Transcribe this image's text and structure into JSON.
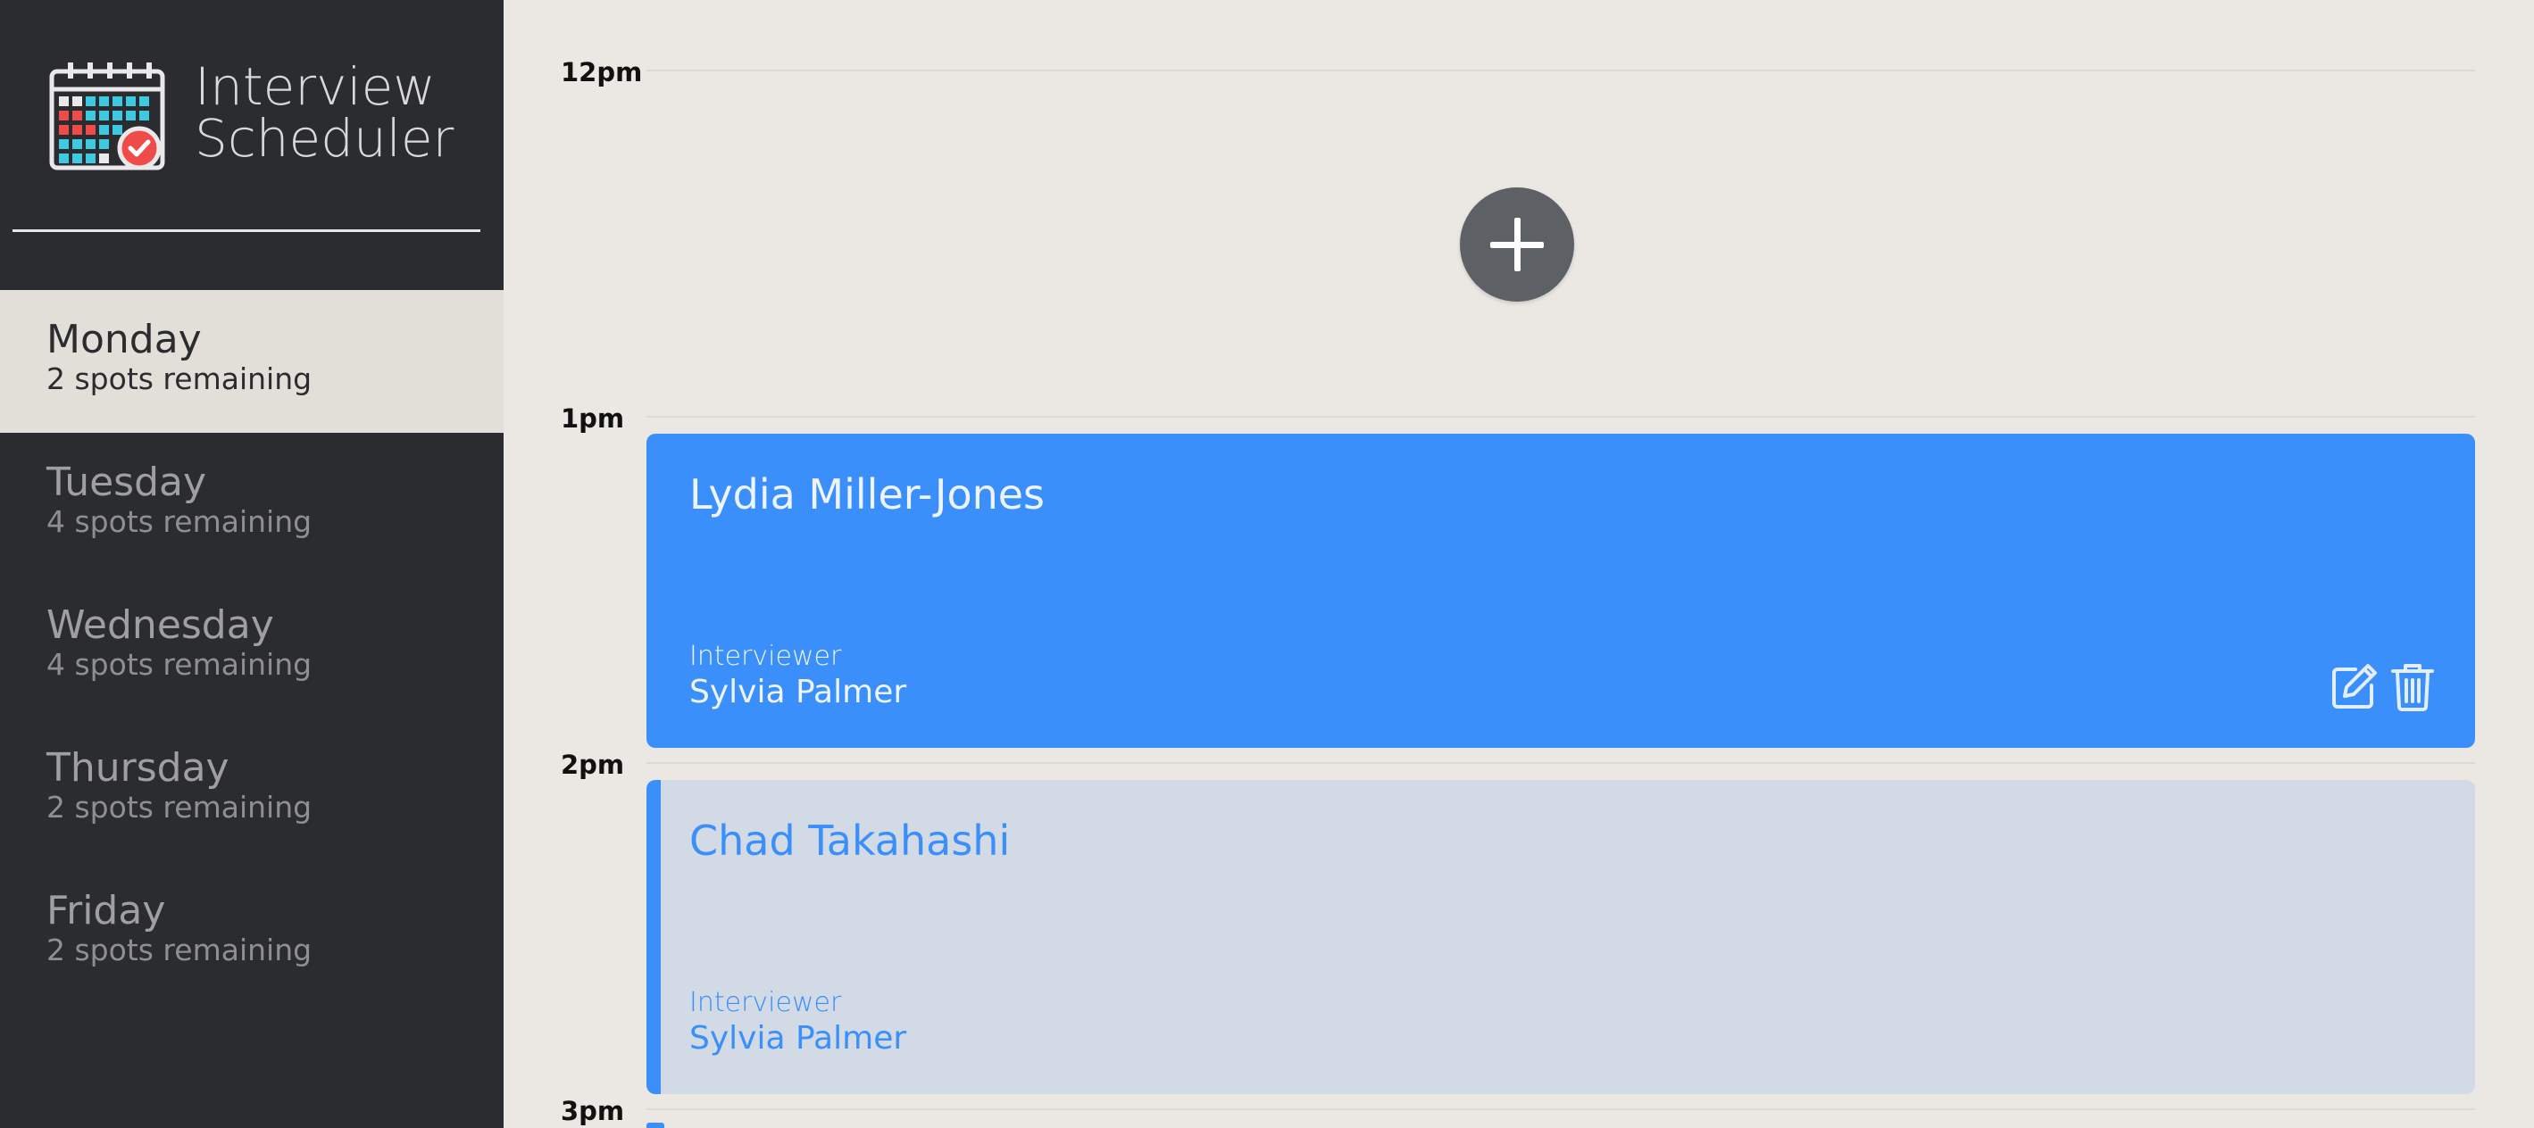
{
  "app": {
    "title_line1": "Interview",
    "title_line2": "Scheduler"
  },
  "sidebar": {
    "days": [
      {
        "name": "Monday",
        "spots": "2 spots remaining",
        "selected": true
      },
      {
        "name": "Tuesday",
        "spots": "4 spots remaining",
        "selected": false
      },
      {
        "name": "Wednesday",
        "spots": "4 spots remaining",
        "selected": false
      },
      {
        "name": "Thursday",
        "spots": "2 spots remaining",
        "selected": false
      },
      {
        "name": "Friday",
        "spots": "2 spots remaining",
        "selected": false
      }
    ]
  },
  "schedule": {
    "hours": [
      "12pm",
      "1pm",
      "2pm",
      "3pm"
    ],
    "appointments": [
      {
        "student": "Lydia Miller-Jones",
        "interviewer_label": "Interviewer",
        "interviewer": "Sylvia Palmer",
        "style": "hovered"
      },
      {
        "student": "Chad Takahashi",
        "interviewer_label": "Interviewer",
        "interviewer": "Sylvia Palmer",
        "style": "default"
      }
    ]
  },
  "icons": {
    "logo": "calendar-check-icon",
    "add": "plus-icon",
    "edit": "edit-icon",
    "delete": "trash-icon"
  },
  "colors": {
    "sidebar": "#2a2c2f",
    "accent": "#3a8ffa",
    "background": "#ebe8e3",
    "selected_day": "#e2dfd9"
  }
}
